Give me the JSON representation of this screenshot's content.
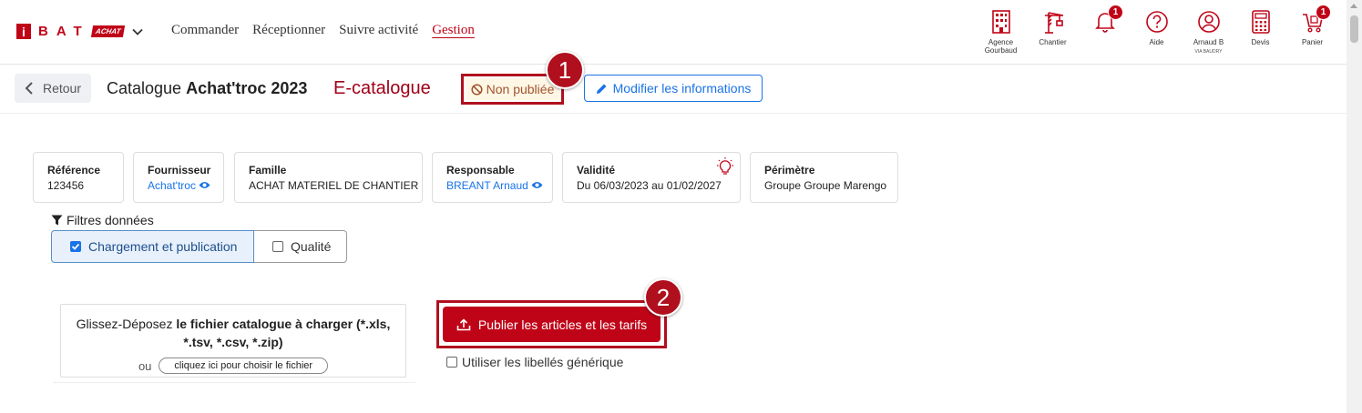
{
  "brand": {
    "letter": "i",
    "name": "BAT",
    "sub": "ACHAT",
    "color": "#c00418"
  },
  "nav": {
    "links": [
      "Commander",
      "Réceptionner",
      "Suivre activité",
      "Gestion"
    ],
    "active": "Gestion"
  },
  "icons": [
    {
      "icon": "building-icon",
      "label": "Agence",
      "label2": "Gourbaud"
    },
    {
      "icon": "crane-icon",
      "label": "Chantier"
    },
    {
      "icon": "bell-icon",
      "label": "",
      "badge": "1"
    },
    {
      "icon": "help-icon",
      "label": "Aide"
    },
    {
      "icon": "user-icon",
      "label": "Arnaud B",
      "sub": "VIA BAUDRY"
    },
    {
      "icon": "calculator-icon",
      "label": "Devis"
    },
    {
      "icon": "cart-icon",
      "label": "Panier",
      "badge": "1"
    }
  ],
  "header": {
    "back": "Retour",
    "title_prefix": "Catalogue",
    "title_name": "Achat'troc 2023",
    "type": "E-catalogue",
    "status": "Non publiée",
    "modify": "Modifier les informations"
  },
  "markers": [
    "1",
    "2"
  ],
  "cards": [
    {
      "title": "Référence",
      "value": "123456"
    },
    {
      "title": "Fournisseur",
      "value": "Achat'troc"
    },
    {
      "title": "Famille",
      "value": "ACHAT MATERIEL DE CHANTIER"
    },
    {
      "title": "Responsable",
      "value": "BREANT Arnaud"
    },
    {
      "title": "Validité",
      "value": "Du 06/03/2023 au 01/02/2027"
    },
    {
      "title": "Périmètre",
      "value": "Groupe Groupe Marengo"
    }
  ],
  "filters": {
    "label": "Filtres données",
    "tabs": [
      {
        "label": "Chargement et publication",
        "checked": true
      },
      {
        "label": "Qualité",
        "checked": false
      }
    ]
  },
  "dropzone": {
    "prefix": "Glissez-Déposez ",
    "bold": "le fichier catalogue à charger (*.xls, *.tsv, *.csv, *.zip)",
    "or": "ou",
    "choose": "cliquez ici pour choisir le fichier"
  },
  "publish": "Publier les articles et les tarifs",
  "generic_label": "Utiliser les libellés générique"
}
